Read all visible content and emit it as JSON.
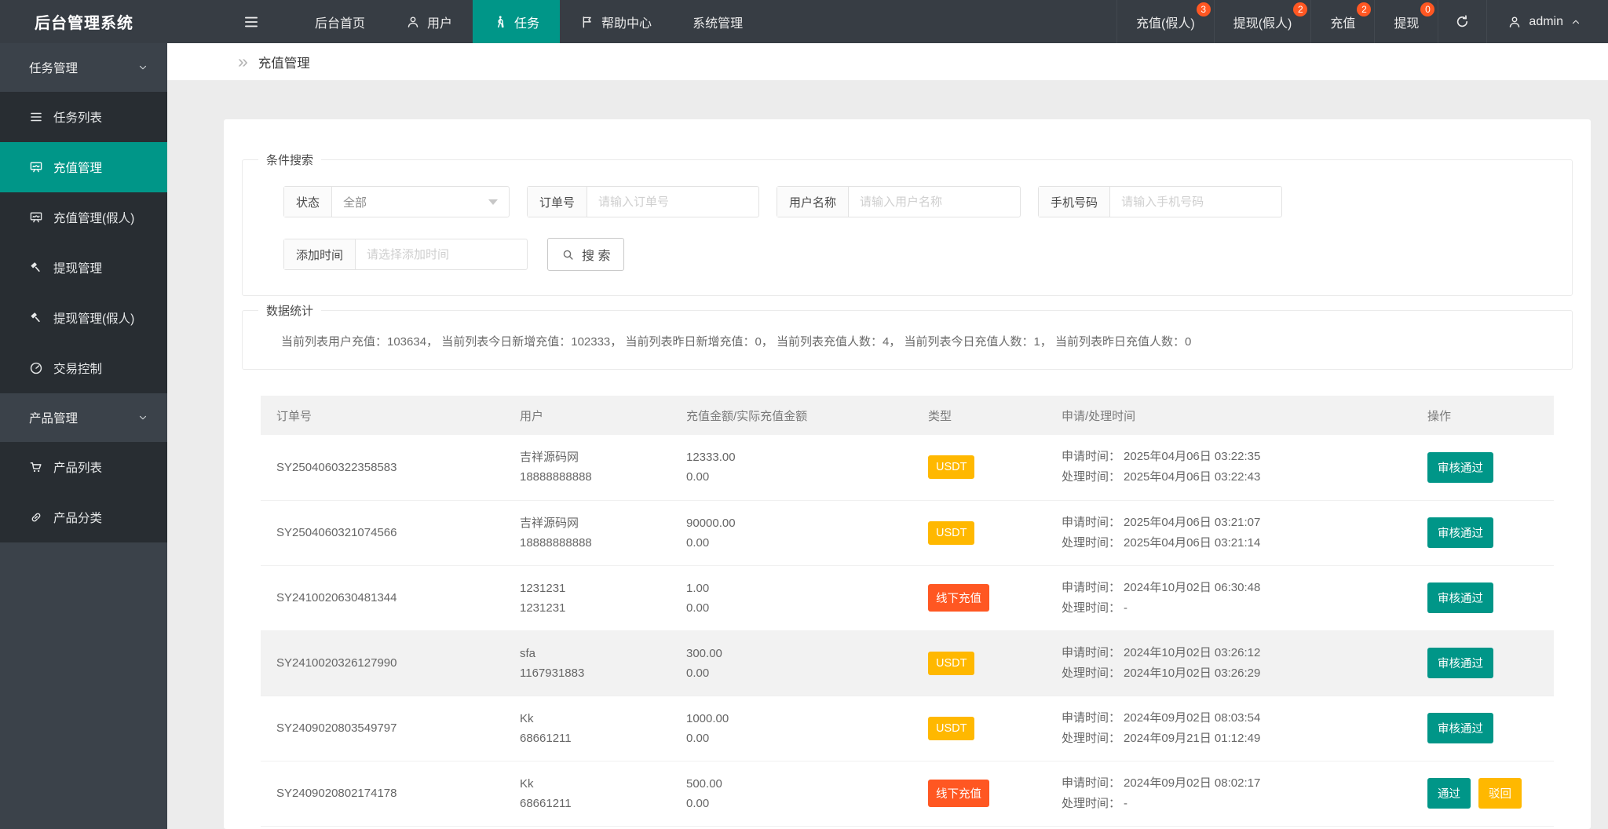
{
  "app": {
    "title": "后台管理系统"
  },
  "colors": {
    "accent": "#009688",
    "warning": "#ffb800",
    "danger": "#ff5722",
    "badge": "#ff5722",
    "topbar_bg": "#373d44",
    "sidebar_bg": "#3b424a",
    "submenu_bg": "#282d32"
  },
  "topnav": {
    "hamburger_icon": "spread-icon",
    "items": [
      {
        "label": "后台首页",
        "icon": null,
        "active": false
      },
      {
        "label": "用户",
        "icon": "user-icon",
        "active": false
      },
      {
        "label": "任务",
        "icon": "walking-icon",
        "active": true
      },
      {
        "label": "帮助中心",
        "icon": "flag-icon",
        "active": false
      },
      {
        "label": "系统管理",
        "icon": null,
        "active": false
      }
    ],
    "quick_items": [
      {
        "label": "充值(假人)",
        "badge": "3"
      },
      {
        "label": "提现(假人)",
        "badge": "2"
      },
      {
        "label": "充值",
        "badge": "2"
      },
      {
        "label": "提现",
        "badge": "0"
      }
    ],
    "user": {
      "name": "admin"
    }
  },
  "sidebar": {
    "groups": [
      {
        "label": "任务管理",
        "chevron": "chevron-down-icon",
        "items": [
          {
            "label": "任务列表",
            "icon": "list-icon",
            "active": false
          },
          {
            "label": "充值管理",
            "icon": "board-icon",
            "active": true
          },
          {
            "label": "充值管理(假人)",
            "icon": "board-icon",
            "active": false
          },
          {
            "label": "提现管理",
            "icon": "gavel-icon",
            "active": false
          },
          {
            "label": "提现管理(假人)",
            "icon": "gavel-icon",
            "active": false
          },
          {
            "label": "交易控制",
            "icon": "gauge-icon",
            "active": false
          }
        ]
      },
      {
        "label": "产品管理",
        "chevron": "chevron-down-icon",
        "items": [
          {
            "label": "产品列表",
            "icon": "cart-icon",
            "active": false
          },
          {
            "label": "产品分类",
            "icon": "link-icon",
            "active": false
          }
        ]
      }
    ]
  },
  "breadcrumb": {
    "current": "充值管理"
  },
  "search": {
    "legend": "条件搜索",
    "fields": [
      {
        "label": "状态",
        "type": "select",
        "value": "全部"
      },
      {
        "label": "订单号",
        "type": "text",
        "placeholder": "请输入订单号"
      },
      {
        "label": "用户名称",
        "type": "text",
        "placeholder": "请输入用户名称"
      },
      {
        "label": "手机号码",
        "type": "text",
        "placeholder": "请输入手机号码"
      },
      {
        "label": "添加时间",
        "type": "text",
        "placeholder": "请选择添加时间"
      }
    ],
    "button": {
      "label": "搜 索"
    }
  },
  "stats": {
    "legend": "数据统计",
    "text": "当前列表用户充值：103634， 当前列表今日新增充值：102333， 当前列表昨日新增充值：0， 当前列表充值人数：4， 当前列表今日充值人数：1， 当前列表昨日充值人数：0"
  },
  "table": {
    "columns": [
      "订单号",
      "用户",
      "充值金额/实际充值金额",
      "类型",
      "申请/处理时间",
      "操作"
    ],
    "apply_label": "申请时间：",
    "process_label": "处理时间：",
    "rows": [
      {
        "order": "SY2504060322358583",
        "user": "吉祥源码网",
        "phone": "18888888888",
        "amount": "12333.00",
        "actual": "0.00",
        "type": {
          "label": "USDT",
          "style": "warning"
        },
        "apply": "2025年04月06日 03:22:35",
        "process": "2025年04月06日 03:22:43",
        "actions": [
          {
            "label": "审核通过",
            "style": "primary"
          }
        ],
        "highlight": false
      },
      {
        "order": "SY2504060321074566",
        "user": "吉祥源码网",
        "phone": "18888888888",
        "amount": "90000.00",
        "actual": "0.00",
        "type": {
          "label": "USDT",
          "style": "warning"
        },
        "apply": "2025年04月06日 03:21:07",
        "process": "2025年04月06日 03:21:14",
        "actions": [
          {
            "label": "审核通过",
            "style": "primary"
          }
        ],
        "highlight": false
      },
      {
        "order": "SY2410020630481344",
        "user": "1231231",
        "phone": "1231231",
        "amount": "1.00",
        "actual": "0.00",
        "type": {
          "label": "线下充值",
          "style": "danger"
        },
        "apply": "2024年10月02日 06:30:48",
        "process": "-",
        "actions": [
          {
            "label": "审核通过",
            "style": "primary"
          }
        ],
        "highlight": false
      },
      {
        "order": "SY2410020326127990",
        "user": "sfa",
        "phone": "1167931883",
        "amount": "300.00",
        "actual": "0.00",
        "type": {
          "label": "USDT",
          "style": "warning"
        },
        "apply": "2024年10月02日 03:26:12",
        "process": "2024年10月02日 03:26:29",
        "actions": [
          {
            "label": "审核通过",
            "style": "primary"
          }
        ],
        "highlight": true
      },
      {
        "order": "SY2409020803549797",
        "user": "Kk",
        "phone": "68661211",
        "amount": "1000.00",
        "actual": "0.00",
        "type": {
          "label": "USDT",
          "style": "warning"
        },
        "apply": "2024年09月02日 08:03:54",
        "process": "2024年09月21日 01:12:49",
        "actions": [
          {
            "label": "审核通过",
            "style": "primary"
          }
        ],
        "highlight": false
      },
      {
        "order": "SY2409020802174178",
        "user": "Kk",
        "phone": "68661211",
        "amount": "500.00",
        "actual": "0.00",
        "type": {
          "label": "线下充值",
          "style": "danger"
        },
        "apply": "2024年09月02日 08:02:17",
        "process": "-",
        "actions": [
          {
            "label": "通过",
            "style": "primary"
          },
          {
            "label": "驳回",
            "style": "warning"
          }
        ],
        "highlight": false
      }
    ]
  }
}
